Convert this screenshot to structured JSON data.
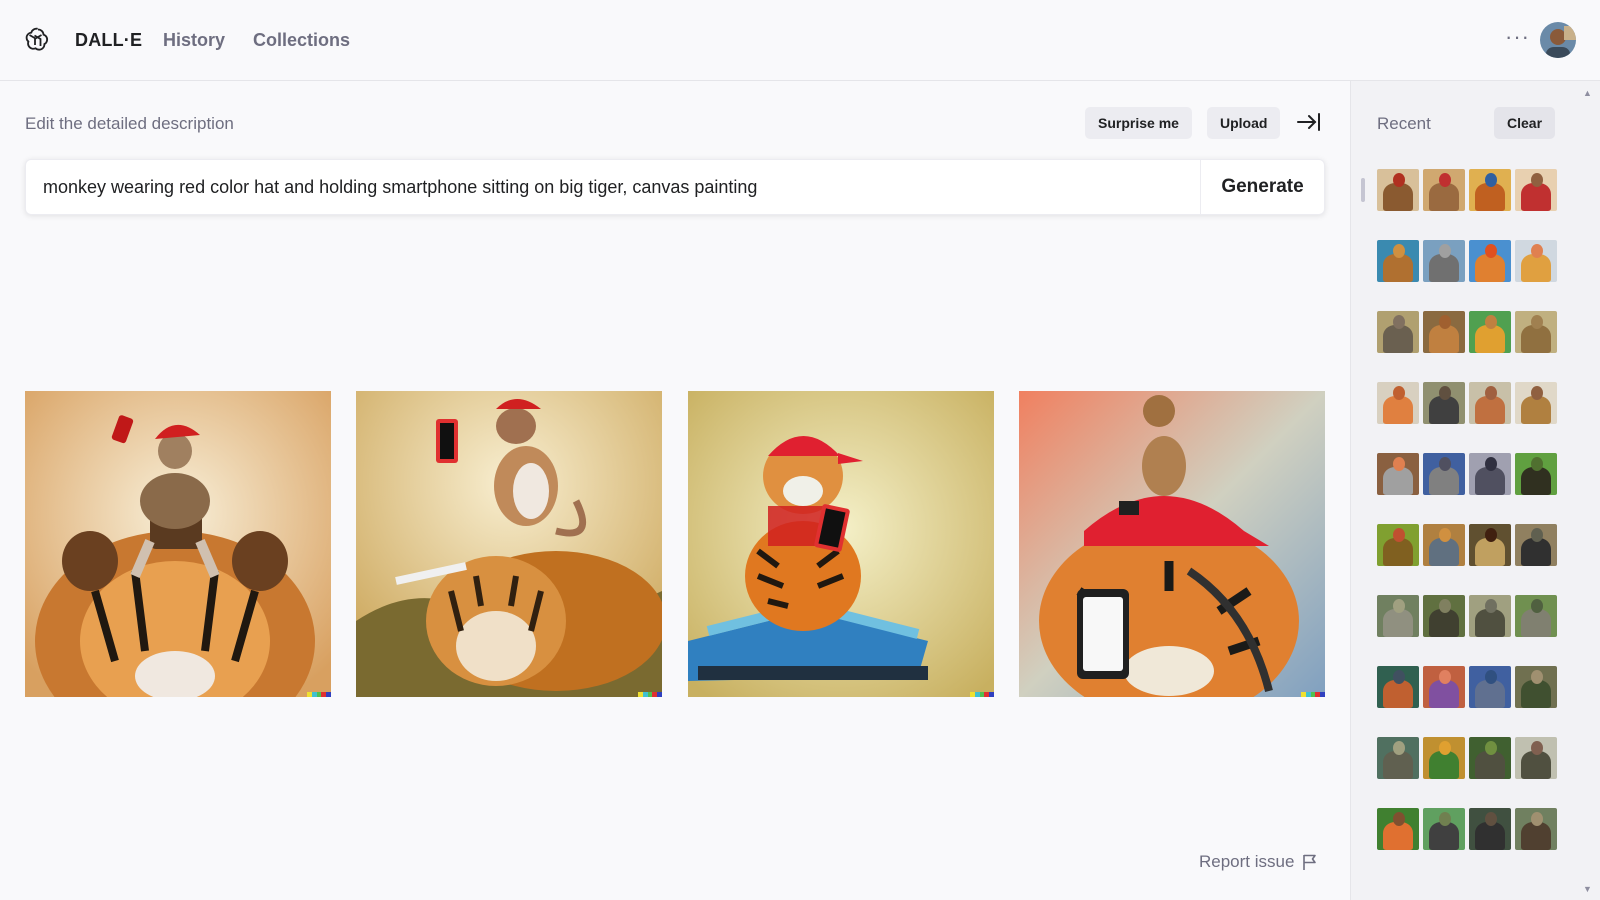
{
  "header": {
    "title": "DALL·E",
    "nav": [
      {
        "label": "History"
      },
      {
        "label": "Collections"
      }
    ],
    "more_label": "···"
  },
  "editor": {
    "label": "Edit the detailed description",
    "surprise_label": "Surprise me",
    "upload_label": "Upload",
    "prompt": "monkey wearing red color hat and holding smartphone sitting on big tiger, canvas painting",
    "generate_label": "Generate"
  },
  "results": [
    {
      "subject": "monkey-on-tiger-head",
      "bg": "#e8c48a"
    },
    {
      "subject": "monkey-on-tiger-back",
      "bg": "#d9b36a"
    },
    {
      "subject": "tiger-cub-with-cap",
      "bg": "#d8cc8a"
    },
    {
      "subject": "tiger-with-red-cap-and-phone",
      "bg": "#c9b89a"
    }
  ],
  "footer": {
    "report_label": "Report issue"
  },
  "sidebar": {
    "recent_label": "Recent",
    "clear_label": "Clear",
    "rows": [
      [
        [
          "#d8c09a",
          "#8a5a30",
          "#b03020"
        ],
        [
          "#d0a870",
          "#9a6a40",
          "#c03030"
        ],
        [
          "#e0b050",
          "#c06020",
          "#3060a0"
        ],
        [
          "#e8d0b0",
          "#c03030",
          "#906040"
        ]
      ],
      [
        [
          "#3a8ab0",
          "#b07030",
          "#d09040"
        ],
        [
          "#7aa0c0",
          "#707070",
          "#a0a0a0"
        ],
        [
          "#4a90d0",
          "#e08030",
          "#e05020"
        ],
        [
          "#d0d8e0",
          "#e0a040",
          "#e08050"
        ]
      ],
      [
        [
          "#b0a070",
          "#6a6050",
          "#807060"
        ],
        [
          "#8a6a40",
          "#c08040",
          "#a06030"
        ],
        [
          "#50a050",
          "#e0a030",
          "#c08040"
        ],
        [
          "#c0b080",
          "#907040",
          "#a08050"
        ]
      ],
      [
        [
          "#d8d0c0",
          "#e08040",
          "#c06030"
        ],
        [
          "#909070",
          "#404040",
          "#605040"
        ],
        [
          "#c8c0a8",
          "#c07040",
          "#a06040"
        ],
        [
          "#e0d8c8",
          "#b08040",
          "#906040"
        ]
      ],
      [
        [
          "#8a6040",
          "#a0a0a0",
          "#e08050"
        ],
        [
          "#4060a0",
          "#808080",
          "#505060"
        ],
        [
          "#a0a0b0",
          "#505060",
          "#303040"
        ],
        [
          "#60a040",
          "#303020",
          "#507030"
        ]
      ],
      [
        [
          "#80a030",
          "#806020",
          "#c05030"
        ],
        [
          "#b08040",
          "#607080",
          "#d09040"
        ],
        [
          "#605030",
          "#c0a060",
          "#402010"
        ],
        [
          "#908060",
          "#303030",
          "#606050"
        ]
      ],
      [
        [
          "#708060",
          "#909080",
          "#a0a080"
        ],
        [
          "#607040",
          "#404030",
          "#808060"
        ],
        [
          "#a0a080",
          "#505040",
          "#707060"
        ],
        [
          "#709050",
          "#808070",
          "#506040"
        ]
      ],
      [
        [
          "#306050",
          "#c06030",
          "#405060"
        ],
        [
          "#c06040",
          "#8050a0",
          "#e08060"
        ],
        [
          "#4060a0",
          "#607090",
          "#305080"
        ],
        [
          "#707050",
          "#405030",
          "#a09070"
        ]
      ],
      [
        [
          "#507060",
          "#606050",
          "#a0a080"
        ],
        [
          "#c09030",
          "#408030",
          "#e0a030"
        ],
        [
          "#406030",
          "#505040",
          "#709040"
        ],
        [
          "#c0c0b0",
          "#505040",
          "#806050"
        ]
      ],
      [
        [
          "#408030",
          "#e07030",
          "#805030"
        ],
        [
          "#60a060",
          "#404040",
          "#708050"
        ],
        [
          "#405040",
          "#303030",
          "#605040"
        ],
        [
          "#708060",
          "#504030",
          "#a09070"
        ]
      ]
    ]
  },
  "colors": {
    "accent_text": "#202123",
    "muted_text": "#6e6e80",
    "button_bg": "#ececf1"
  }
}
